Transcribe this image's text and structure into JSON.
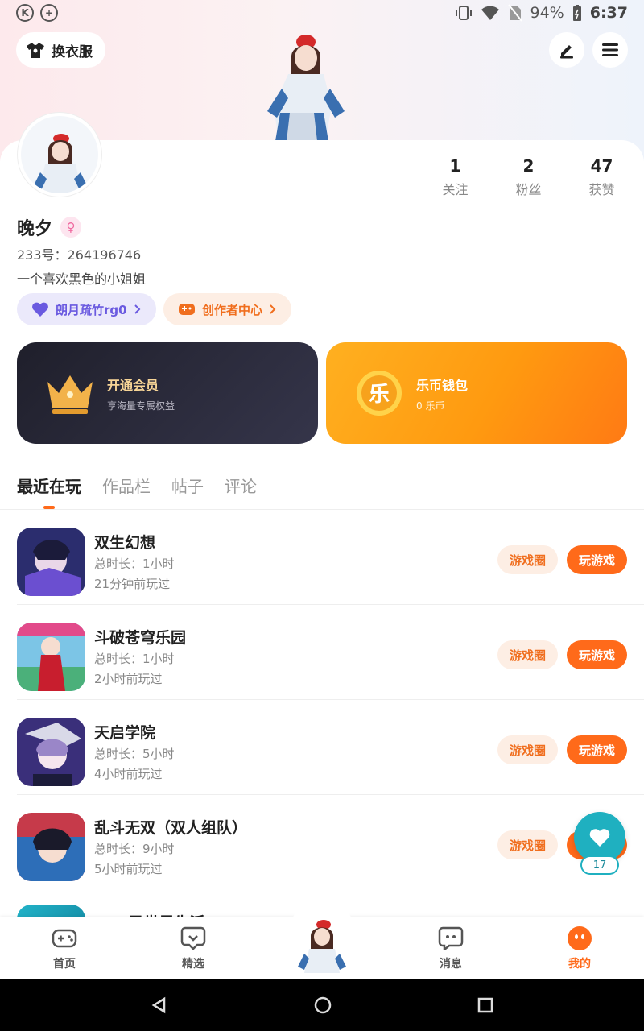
{
  "status_bar": {
    "battery": "94%",
    "time": "6:37",
    "left_icons": [
      "K",
      "+"
    ]
  },
  "header": {
    "outfit_label": "换衣服"
  },
  "stats": [
    {
      "num": "1",
      "label": "关注"
    },
    {
      "num": "2",
      "label": "粉丝"
    },
    {
      "num": "47",
      "label": "获赞"
    }
  ],
  "profile": {
    "username": "晚夕",
    "gender_symbol": "♀",
    "uid": "233号：264196746",
    "bio": "一个喜欢黑色的小姐姐"
  },
  "chips": {
    "family": "朗月疏竹rg0",
    "creator": "创作者中心"
  },
  "cards": {
    "vip_title": "开通会员",
    "vip_sub": "享海量专属权益",
    "wallet_icon_char": "乐",
    "wallet_title": "乐币钱包",
    "wallet_sub": "0 乐币"
  },
  "tabs": [
    "最近在玩",
    "作品栏",
    "帖子",
    "评论"
  ],
  "games": [
    {
      "name": "双生幻想",
      "duration": "总时长：1小时",
      "last_played": "21分钟前玩过",
      "circle_label": "游戏圈",
      "play_label": "玩游戏"
    },
    {
      "name": "斗破苍穹乐园",
      "duration": "总时长：1小时",
      "last_played": "2小时前玩过",
      "circle_label": "游戏圈",
      "play_label": "玩游戏"
    },
    {
      "name": "天启学院",
      "duration": "总时长：5小时",
      "last_played": "4小时前玩过",
      "circle_label": "游戏圈",
      "play_label": "玩游戏"
    },
    {
      "name": "乱斗无双（双人组队）",
      "duration": "总时长：9小时",
      "last_played": "5小时前玩过",
      "circle_label": "游戏圈",
      "play_label": "玩游戏"
    }
  ],
  "partial_game": {
    "name": "Pet 异世界生活"
  },
  "float_like": {
    "count": "17"
  },
  "bottom_nav": [
    {
      "label": "首页",
      "icon": "gamepad-icon"
    },
    {
      "label": "精选",
      "icon": "heart-chat-icon"
    },
    {
      "label": "消息",
      "icon": "message-icon"
    },
    {
      "label": "我的",
      "icon": "profile-face-icon"
    }
  ],
  "colors": {
    "accent": "#ff6a1a",
    "creator_chip": "#fdeee4",
    "family_chip": "#ebe9fb",
    "teal": "#1fb0c0"
  }
}
